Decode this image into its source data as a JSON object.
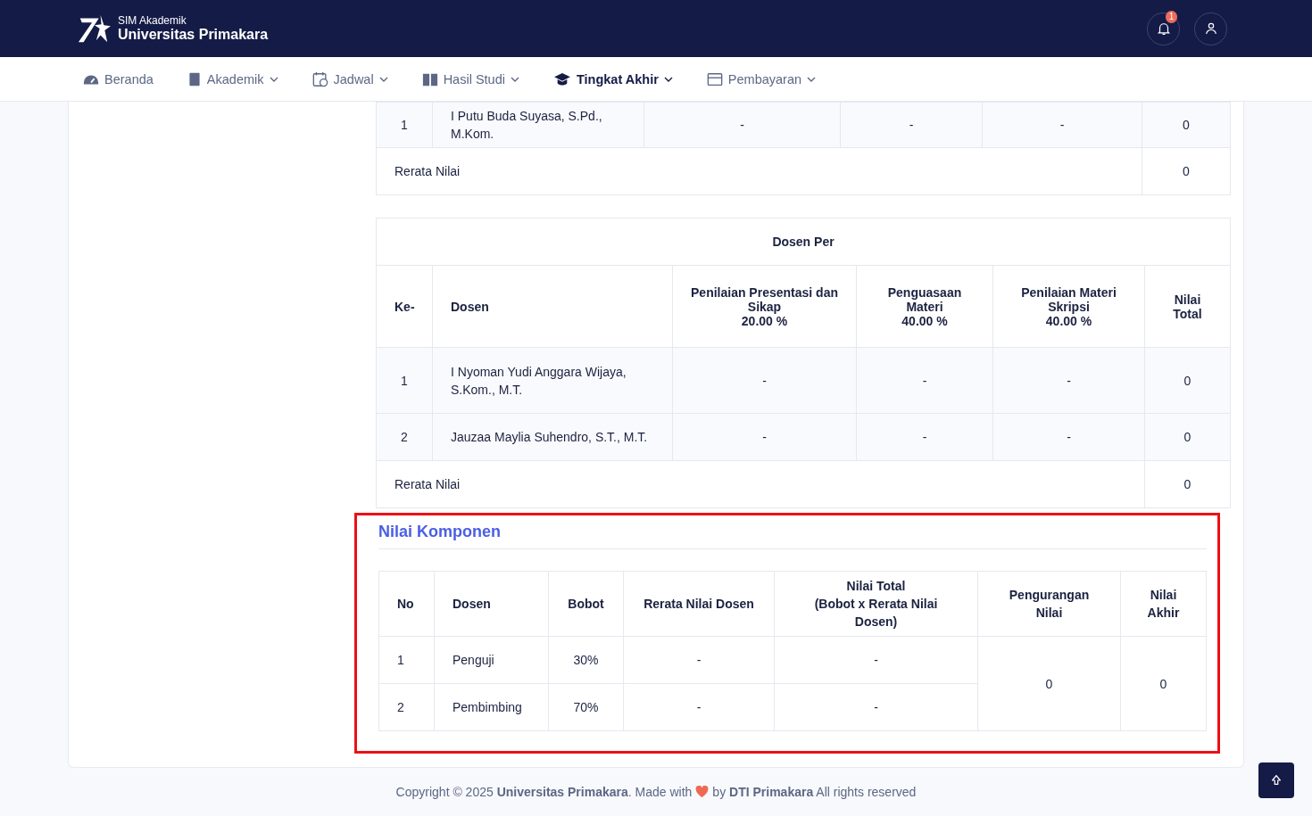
{
  "header": {
    "subtitle": "SIM Akademik",
    "title": "Universitas Primakara",
    "notification_count": "1"
  },
  "nav": [
    {
      "label": "Beranda",
      "dropdown": false,
      "selected": false
    },
    {
      "label": "Akademik",
      "dropdown": true,
      "selected": false
    },
    {
      "label": "Jadwal",
      "dropdown": true,
      "selected": false
    },
    {
      "label": "Hasil Studi",
      "dropdown": true,
      "selected": false
    },
    {
      "label": "Tingkat Akhir",
      "dropdown": true,
      "selected": true
    },
    {
      "label": "Pembayaran",
      "dropdown": true,
      "selected": false
    }
  ],
  "penguji_table": {
    "rows": [
      {
        "no": "1",
        "dosen": "I Putu Buda Suyasa, S.Pd., M.Kom.",
        "scores": [
          "-",
          "-",
          "-"
        ],
        "total": "0"
      }
    ],
    "average_label": "Rerata Nilai",
    "average": "0"
  },
  "pembimbing_table": {
    "title": "Dosen Per",
    "columns": [
      {
        "lines": [
          "Ke-"
        ]
      },
      {
        "lines": [
          "Dosen"
        ]
      },
      {
        "lines": [
          "Penilaian Presentasi dan Sikap",
          "20.00 %"
        ]
      },
      {
        "lines": [
          "Penguasaan Materi",
          "40.00 %"
        ]
      },
      {
        "lines": [
          "Penilaian Materi Skripsi",
          "40.00 %"
        ]
      },
      {
        "lines": [
          "Nilai Total"
        ]
      }
    ],
    "rows": [
      {
        "no": "1",
        "dosen": "I Nyoman Yudi Anggara Wijaya, S.Kom., M.T.",
        "scores": [
          "-",
          "-",
          "-"
        ],
        "total": "0"
      },
      {
        "no": "2",
        "dosen": "Jauzaa Maylia Suhendro, S.T., M.T.",
        "scores": [
          "-",
          "-",
          "-"
        ],
        "total": "0"
      }
    ],
    "average_label": "Rerata Nilai",
    "average": "0"
  },
  "komponen": {
    "title": "Nilai Komponen",
    "highlighted": true,
    "columns": [
      {
        "lines": [
          "No"
        ]
      },
      {
        "lines": [
          "Dosen"
        ]
      },
      {
        "lines": [
          "Bobot"
        ]
      },
      {
        "lines": [
          "Rerata Nilai Dosen"
        ]
      },
      {
        "lines": [
          "Nilai Total",
          "(Bobot x Rerata Nilai Dosen)"
        ]
      },
      {
        "lines": [
          "Pengurangan Nilai"
        ]
      },
      {
        "lines": [
          "Nilai Akhir"
        ]
      }
    ],
    "rows": [
      {
        "no": "1",
        "dosen": "Penguji",
        "bobot": "30%",
        "rerata": "-",
        "total": "-"
      },
      {
        "no": "2",
        "dosen": "Pembimbing",
        "bobot": "70%",
        "rerata": "-",
        "total": "-"
      }
    ],
    "pengurangan": "0",
    "nilai_akhir": "0"
  },
  "footer": {
    "before": "Copyright © 2025 **Universitas Primakara**. Made with",
    "after": "by **DTI Primakara** All rights reserved"
  }
}
